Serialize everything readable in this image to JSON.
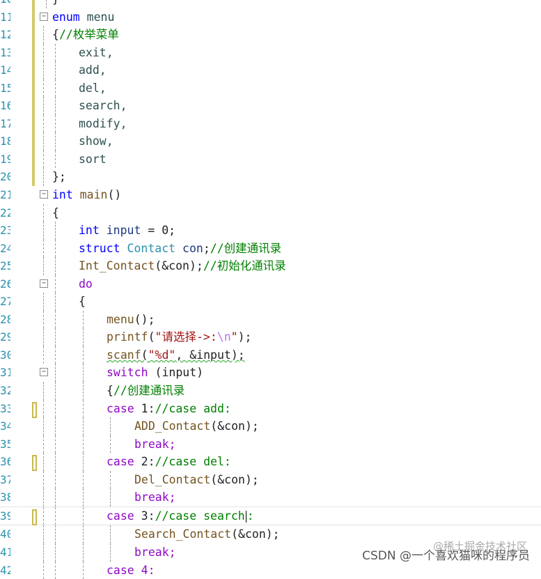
{
  "line_numbers": [
    "10",
    "11",
    "12",
    "13",
    "14",
    "15",
    "16",
    "17",
    "18",
    "19",
    "20",
    "21",
    "22",
    "23",
    "24",
    "25",
    "26",
    "27",
    "28",
    "29",
    "30",
    "31",
    "32",
    "33",
    "34",
    "35",
    "36",
    "37",
    "38",
    "39",
    "40",
    "41",
    "42"
  ],
  "code": {
    "l10": "}",
    "l11_kw": "enum",
    "l11_name": " menu",
    "l12_brace": "{",
    "l12_comment": "//枚举菜单",
    "l13": "exit,",
    "l14": "add,",
    "l15": "del,",
    "l16": "search,",
    "l17": "modify,",
    "l18": "show,",
    "l19": "sort",
    "l20": "};",
    "l21_kw": "int",
    "l21_fn": " main",
    "l21_rest": "()",
    "l22": "{",
    "l23_kw": "int",
    "l23_var": " input",
    "l23_rest": " = 0;",
    "l24_kw": "struct",
    "l24_type": " Contact",
    "l24_var": " con",
    "l24_semi": ";",
    "l24_comment": "//创建通讯录",
    "l25_fn": "Int_Contact",
    "l25_args": "(&con);",
    "l25_comment": "//初始化通讯录",
    "l26": "do",
    "l27": "{",
    "l28_fn": "menu",
    "l28_rest": "();",
    "l29_fn": "printf",
    "l29_open": "(",
    "l29_str": "\"请选择->:",
    "l29_esc": "\\n",
    "l29_str_end": "\"",
    "l29_close": ");",
    "l30_fn": "scanf",
    "l30_open": "(",
    "l30_str": "\"%d\"",
    "l30_args": ", &input);",
    "l31_kw": "switch",
    "l31_rest": " (input)",
    "l32_brace": "{",
    "l32_comment": "//创建通讯录",
    "l33_kw": "case",
    "l33_rest": " 1:",
    "l33_comment": "//case add:",
    "l34_fn": "ADD_Contact",
    "l34_args": "(&con);",
    "l35": "break;",
    "l36_kw": "case",
    "l36_rest": " 2:",
    "l36_comment": "//case del:",
    "l37_fn": "Del_Contact",
    "l37_args": "(&con);",
    "l38": "break;",
    "l39_kw": "case",
    "l39_rest": " 3:",
    "l39_comment": "//case search",
    "l39_after": ":",
    "l40_fn": "Search_Contact",
    "l40_args": "(&con);",
    "l41": "break;",
    "l42": "case 4:"
  },
  "fold_toggle": "−",
  "watermark_faint": "@稀土掘金技术社区",
  "watermark": "CSDN @一个喜欢猫咪的程序员",
  "colors": {
    "keyword": "#0000ff",
    "control": "#8f08c4",
    "function": "#74531f",
    "comment": "#008000",
    "string": "#a31515",
    "line_number": "#2b91af",
    "change_mark": "#d4c96b"
  }
}
